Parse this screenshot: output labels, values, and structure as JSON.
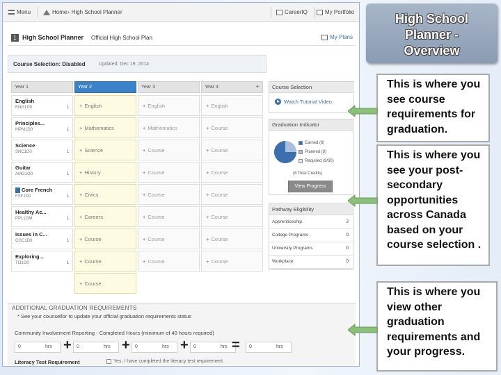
{
  "nav": {
    "menu": "Menu",
    "home": "Home",
    "breadcrumb": "High School Planner",
    "career": "CareerIQ",
    "portfolio": "My Portfolio"
  },
  "planner": {
    "step": "1",
    "title": "High School Planner",
    "subtitle": "Official High School Plan",
    "my_plans": "My Plans"
  },
  "course_selection_bar": {
    "label": "Course Selection: Disabled",
    "updated": "Updated: Dec 19, 2014"
  },
  "years": [
    "Year 1",
    "Year 2",
    "Year 3",
    "Year 4"
  ],
  "add_year": "+",
  "rows": [
    {
      "name": "English",
      "code": "ENG1D0",
      "credit": "1",
      "y2": "English",
      "y3": "English",
      "y4": "English"
    },
    {
      "name": "Principles...",
      "code": "MPM1D0",
      "credit": "1",
      "y2": "Mathematics",
      "y3": "Mathematics",
      "y4": "Course"
    },
    {
      "name": "Science",
      "code": "SNC1D0",
      "credit": "1",
      "y2": "Science",
      "y3": "Course",
      "y4": "Course"
    },
    {
      "name": "Guitar",
      "code": "AMG1O0",
      "credit": "1",
      "y2": "History",
      "y3": "Course",
      "y4": "Course"
    },
    {
      "name": "Core French",
      "code": "FSF1D0",
      "credit": "1",
      "y2": "Civics",
      "y3": "Course",
      "y4": "Course"
    },
    {
      "name": "Healthy Ac...",
      "code": "PPL1OM",
      "credit": "1",
      "y2": "Careers",
      "y3": "Course",
      "y4": "Course"
    },
    {
      "name": "Issues in C...",
      "code": "CGC1D0",
      "credit": "1",
      "y2": "Course",
      "y3": "Course",
      "y4": "Course"
    },
    {
      "name": "Exploring...",
      "code": "TIJ1O0",
      "credit": "1",
      "y2": "Course",
      "y3": "Course",
      "y4": "Course"
    }
  ],
  "extra_y2": "Course",
  "panels": {
    "course_selection": {
      "title": "Course Selection",
      "watch": "Watch Tutorial Video"
    },
    "graduation": {
      "title": "Graduation Indicator",
      "legend": [
        "Earned (8)",
        "Planned (8)",
        "Required (9/30)"
      ],
      "total": "(8 Total Credits)",
      "button": "View Progress",
      "pie_colors": [
        "#3d6fae",
        "#a9c0dc",
        "#e6e6e6"
      ]
    },
    "pathway": {
      "title": "Pathway Eligibility",
      "items": [
        {
          "label": "Apprenticeship",
          "value": "3"
        },
        {
          "label": "College Programs",
          "value": "0"
        },
        {
          "label": "University Programs",
          "value": "0"
        },
        {
          "label": "Workplace",
          "value": "0"
        }
      ]
    }
  },
  "additional": {
    "title": "ADDITIONAL GRADUATION REQUIREMENTS",
    "note": "* See your counsellor to update your official graduation requirements status",
    "community": "Community Involvement Reporting - Completed Hours (minimum of 40 hours required)",
    "hours": [
      "0",
      "0",
      "0",
      "0",
      "0"
    ],
    "unit": "hrs",
    "literacy_label": "Literacy Test Requirement",
    "literacy_check": "Yes, I have completed the literacy test requirement."
  },
  "slide": {
    "title": "High School\nPlanner -\nOverview",
    "callouts": [
      "This is where you see course requirements for graduation.",
      "This is where you see your post-secondary opportunities across Canada based on your course selection .",
      "This is where you view other graduation requirements and your progress."
    ],
    "arrow_color": "#8cbf7a"
  }
}
